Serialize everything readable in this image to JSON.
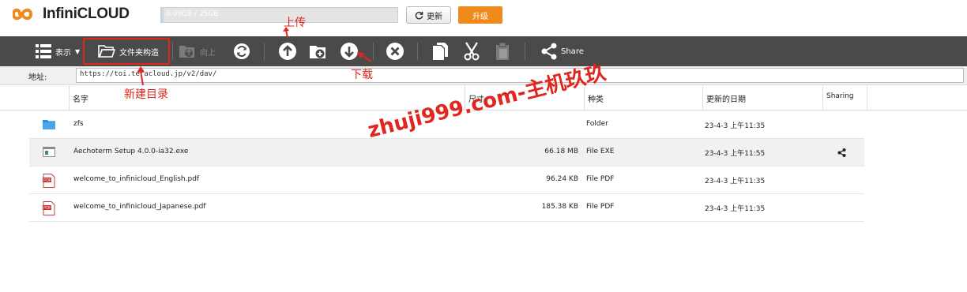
{
  "header": {
    "logo_text": "InfiniCLOUD",
    "quota_text": "0.09GB / 25GB",
    "quota_fraction": 0.0036,
    "refresh_label": "更新",
    "upgrade_label": "升级"
  },
  "toolbar": {
    "view_label": "表示",
    "new_folder_label": "文件夹构造",
    "up_label": "向上",
    "share_label": "Share"
  },
  "address": {
    "label": "地址:",
    "value": "https://toi.teracloud.jp/v2/dav/"
  },
  "columns": {
    "name": "名字",
    "size": "尺寸",
    "type": "种类",
    "date": "更新的日期",
    "sharing": "Sharing"
  },
  "files": [
    {
      "name": "zfs",
      "size": "",
      "type": "Folder",
      "date": "23-4-3 上午11:35",
      "icon": "folder-icon",
      "shared": false
    },
    {
      "name": "Aechoterm Setup 4.0.0-ia32.exe",
      "size": "66.18 MB",
      "type": "File EXE",
      "date": "23-4-3 上午11:55",
      "icon": "exe-file-icon",
      "shared": true
    },
    {
      "name": "welcome_to_infinicloud_English.pdf",
      "size": "96.24 KB",
      "type": "File PDF",
      "date": "23-4-3 上午11:35",
      "icon": "pdf-file-icon",
      "shared": false
    },
    {
      "name": "welcome_to_infinicloud_Japanese.pdf",
      "size": "185.38 KB",
      "type": "File PDF",
      "date": "23-4-3 上午11:35",
      "icon": "pdf-file-icon",
      "shared": false
    }
  ],
  "annotations": {
    "upload": "上传",
    "download": "下载",
    "new_dir": "新建目录",
    "watermark": "zhuji999.com-主机玖玖"
  },
  "colors": {
    "toolbar_bg": "#4a4a4a",
    "upgrade_bg": "#f08a1c",
    "annotation_red": "#e0261e",
    "folder_blue": "#2d8fd8"
  }
}
